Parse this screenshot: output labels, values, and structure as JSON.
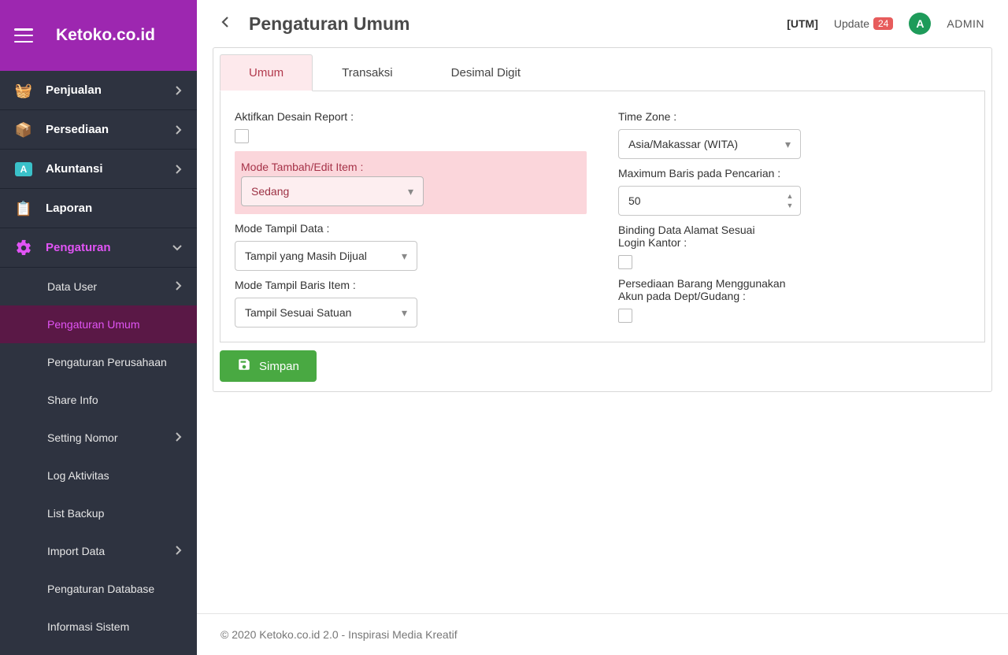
{
  "brand": "Ketoko.co.id",
  "page_title": "Pengaturan Umum",
  "topbar": {
    "utm": "[UTM]",
    "update_label": "Update",
    "update_count": "24",
    "avatar_initial": "A",
    "user_name": "ADMIN"
  },
  "sidebar": {
    "items": [
      {
        "label": "Penjualan",
        "icon": "basket"
      },
      {
        "label": "Persediaan",
        "icon": "box"
      },
      {
        "label": "Akuntansi",
        "icon": "ledger"
      },
      {
        "label": "Laporan",
        "icon": "clipboard"
      },
      {
        "label": "Pengaturan",
        "icon": "gear"
      }
    ],
    "sub_items": [
      {
        "label": "Data User",
        "chev": true
      },
      {
        "label": "Pengaturan Umum",
        "selected": true
      },
      {
        "label": "Pengaturan Perusahaan"
      },
      {
        "label": "Share Info"
      },
      {
        "label": "Setting Nomor",
        "chev": true
      },
      {
        "label": "Log Aktivitas"
      },
      {
        "label": "List Backup"
      },
      {
        "label": "Import Data",
        "chev": true
      },
      {
        "label": "Pengaturan Database"
      },
      {
        "label": "Informasi Sistem"
      }
    ]
  },
  "tabs": [
    "Umum",
    "Transaksi",
    "Desimal Digit"
  ],
  "form": {
    "left": {
      "aktifkan_label": "Aktifkan Desain Report :",
      "mode_tambah_label": "Mode Tambah/Edit Item :",
      "mode_tambah_value": "Sedang",
      "mode_tampil_data_label": "Mode Tampil Data :",
      "mode_tampil_data_value": "Tampil yang Masih Dijual",
      "mode_tampil_baris_label": "Mode Tampil Baris Item :",
      "mode_tampil_baris_value": "Tampil Sesuai Satuan"
    },
    "right": {
      "timezone_label": "Time Zone :",
      "timezone_value": "Asia/Makassar (WITA)",
      "max_baris_label": "Maximum Baris pada Pencarian :",
      "max_baris_value": "50",
      "binding_label": "Binding Data Alamat Sesuai Login Kantor :",
      "persediaan_label": "Persediaan Barang Menggunakan Akun pada Dept/Gudang :"
    }
  },
  "save_button": "Simpan",
  "footer": "© 2020 Ketoko.co.id 2.0 - Inspirasi Media Kreatif"
}
